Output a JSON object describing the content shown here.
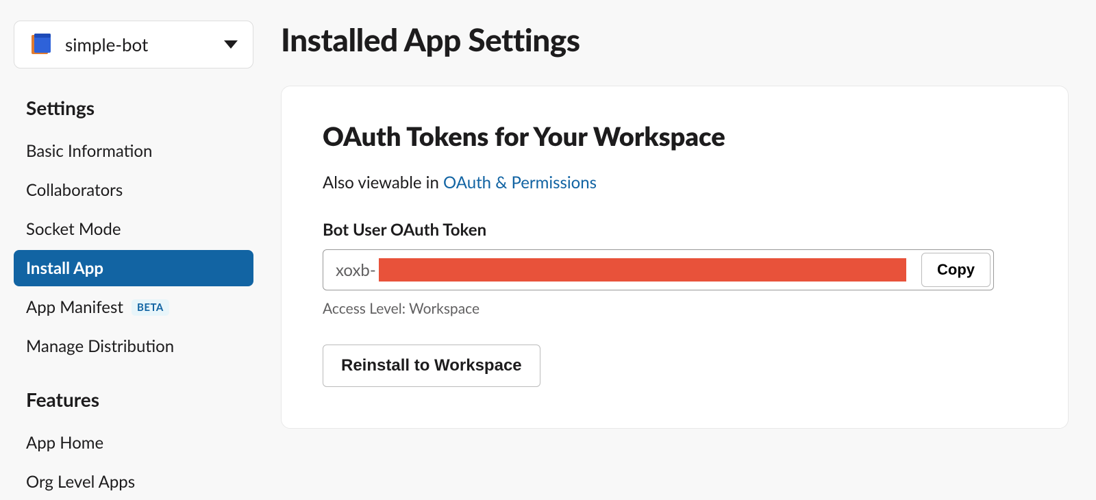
{
  "sidebar": {
    "selector": {
      "app_name": "simple-bot"
    },
    "groups": [
      {
        "title": "Settings",
        "items": [
          {
            "label": "Basic Information",
            "active": false
          },
          {
            "label": "Collaborators",
            "active": false
          },
          {
            "label": "Socket Mode",
            "active": false
          },
          {
            "label": "Install App",
            "active": true
          },
          {
            "label": "App Manifest",
            "active": false,
            "badge": "BETA"
          },
          {
            "label": "Manage Distribution",
            "active": false
          }
        ]
      },
      {
        "title": "Features",
        "items": [
          {
            "label": "App Home",
            "active": false
          },
          {
            "label": "Org Level Apps",
            "active": false
          }
        ]
      }
    ]
  },
  "main": {
    "page_title": "Installed App Settings",
    "card": {
      "title": "OAuth Tokens for Your Workspace",
      "subtext_prefix": "Also viewable in ",
      "subtext_link": "OAuth & Permissions",
      "token_label": "Bot User OAuth Token",
      "token_prefix": "xoxb-",
      "copy_label": "Copy",
      "access_level": "Access Level: Workspace",
      "reinstall_label": "Reinstall to Workspace"
    }
  }
}
